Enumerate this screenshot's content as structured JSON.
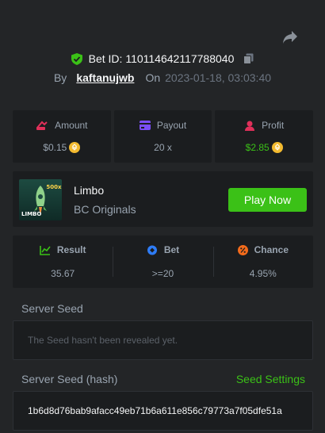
{
  "bet": {
    "id_label": "Bet ID: 110114642117788040",
    "by_label": "By",
    "username": "kaftanujwb",
    "on_label": "On",
    "date": "2023-01-18, 03:03:40"
  },
  "stats": {
    "amount_label": "Amount",
    "amount_value": "$0.15",
    "payout_label": "Payout",
    "payout_value": "20 x",
    "profit_label": "Profit",
    "profit_value": "$2.85"
  },
  "game": {
    "name": "Limbo",
    "provider": "BC Originals",
    "play_label": "Play Now",
    "thumb_badge": "500x",
    "thumb_title": "LIMBO"
  },
  "result": {
    "result_label": "Result",
    "result_value": "35.67",
    "bet_label": "Bet",
    "bet_value": ">=20",
    "chance_label": "Chance",
    "chance_value": "4.95%"
  },
  "server_seed": {
    "title": "Server Seed",
    "placeholder": "The Seed hasn't been revealed yet."
  },
  "server_seed_hash": {
    "title": "Server Seed (hash)",
    "settings_label": "Seed Settings",
    "value": "1b6d8d76bab9afacc49eb71b6a611e856c79773a7f05dfe51a"
  },
  "colors": {
    "background": "#232527",
    "panel": "#1b1d1f",
    "accent_green": "#3bc117",
    "muted_text": "#99a4b0"
  },
  "icons": [
    "share-icon",
    "shield-check-icon",
    "copy-icon",
    "amount-icon",
    "payout-icon",
    "profit-icon",
    "coin-icon",
    "result-icon",
    "bet-icon",
    "chance-icon"
  ]
}
